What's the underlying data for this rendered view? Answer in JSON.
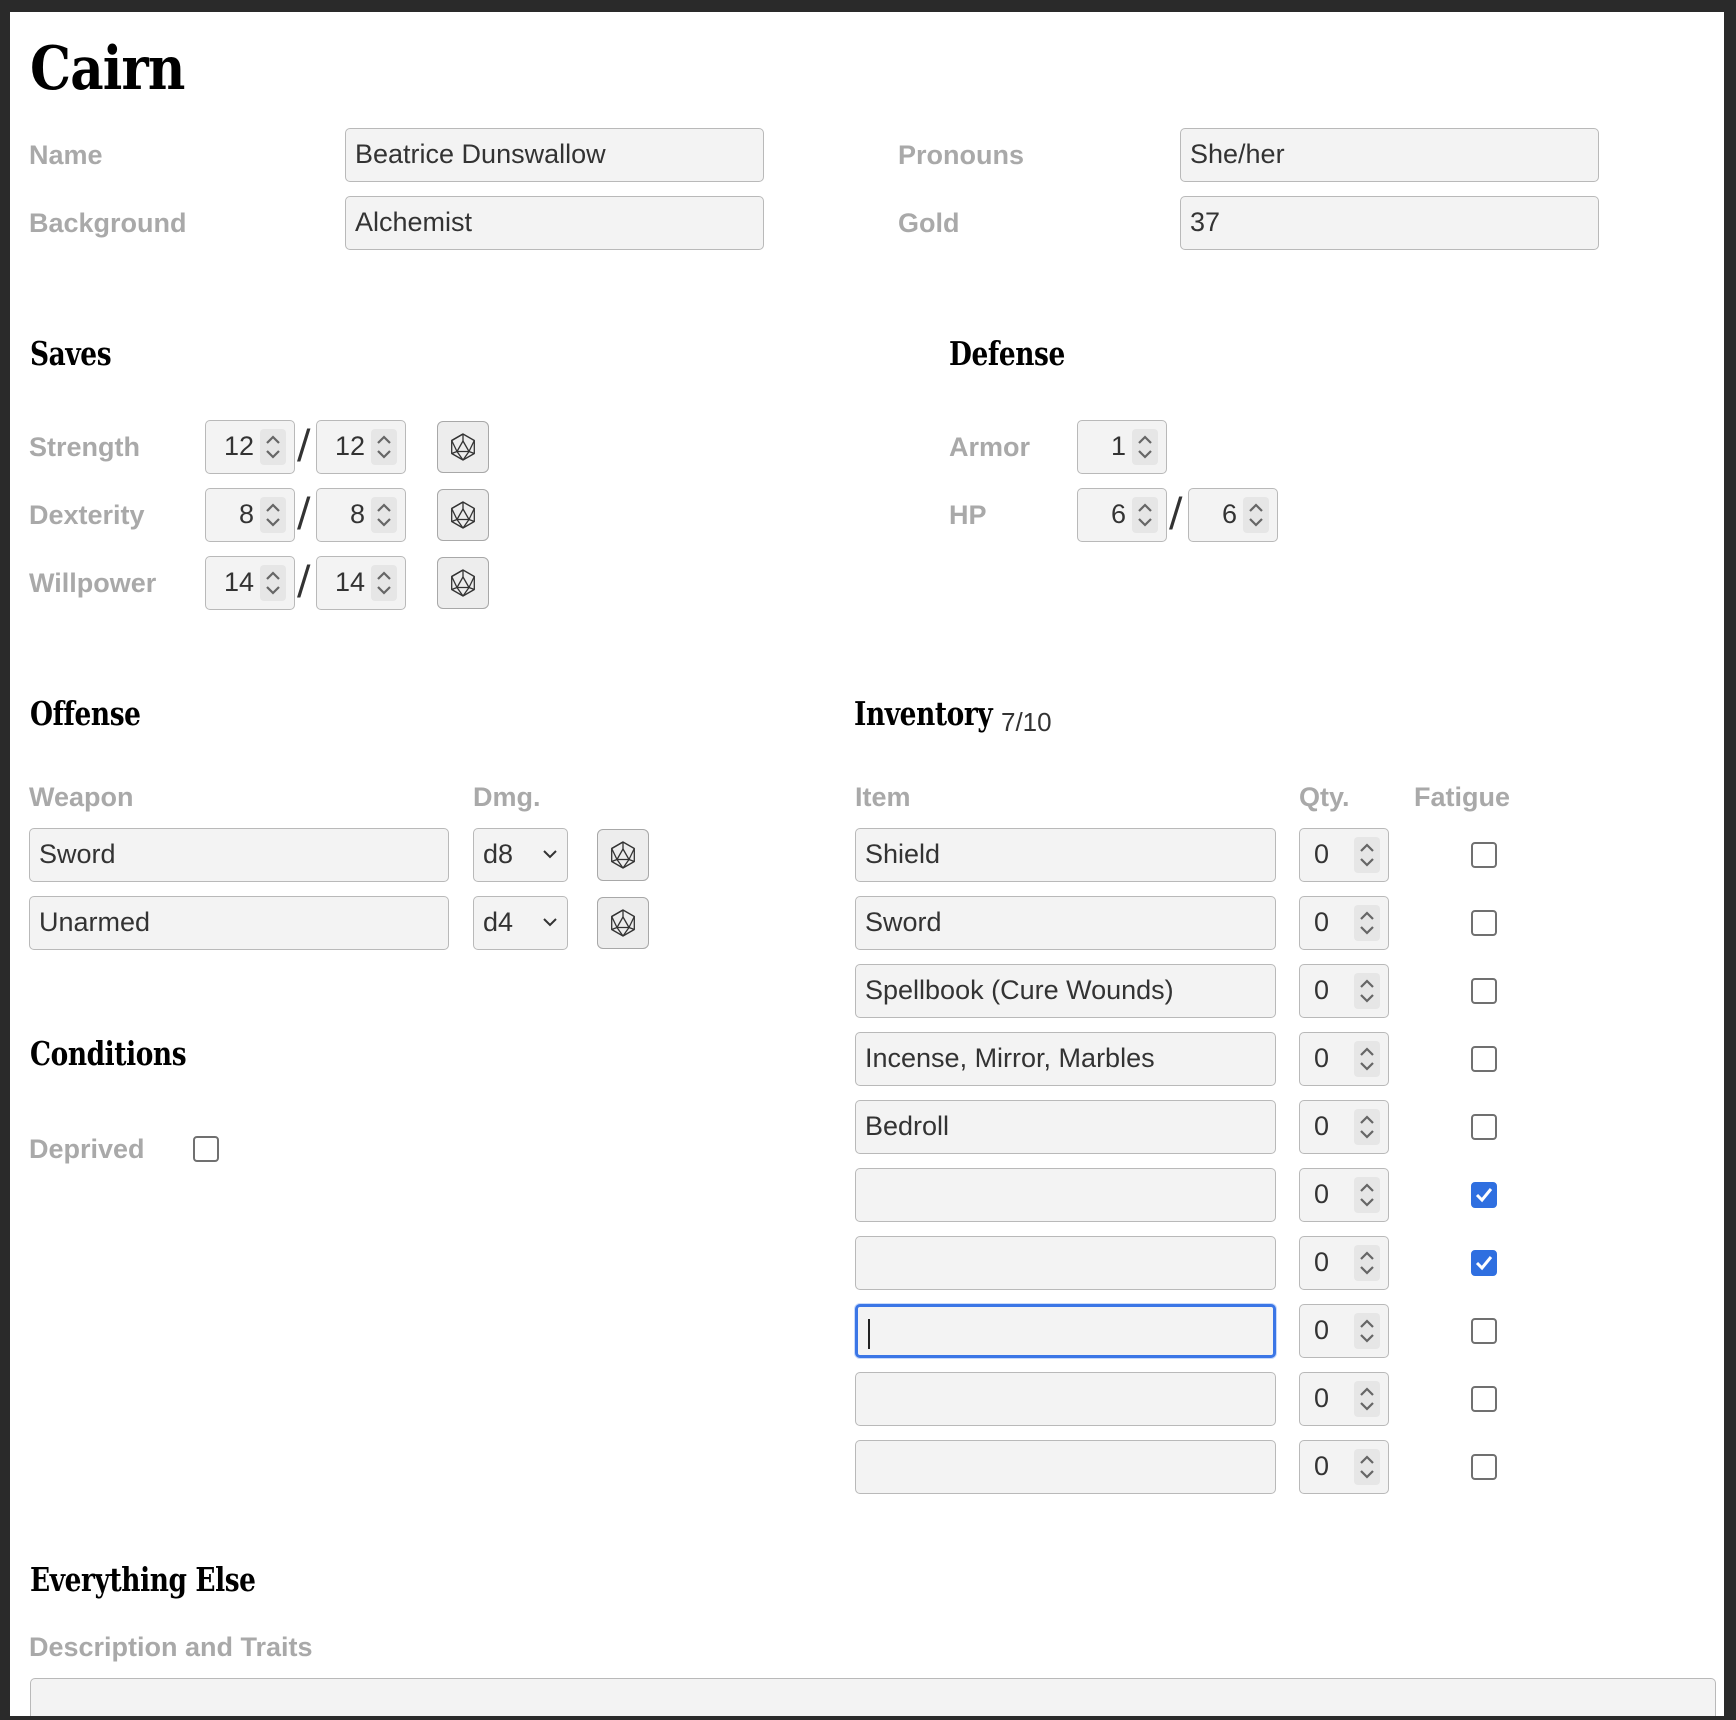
{
  "app": {
    "title": "Cairn"
  },
  "character": {
    "name_label": "Name",
    "name": "Beatrice Dunswallow",
    "pronouns_label": "Pronouns",
    "pronouns": "She/her",
    "background_label": "Background",
    "background": "Alchemist",
    "gold_label": "Gold",
    "gold": "37"
  },
  "saves": {
    "title": "Saves",
    "rows": [
      {
        "label": "Strength",
        "current": "12",
        "max": "12"
      },
      {
        "label": "Dexterity",
        "current": "8",
        "max": "8"
      },
      {
        "label": "Willpower",
        "current": "14",
        "max": "14"
      }
    ],
    "separator": "/"
  },
  "defense": {
    "title": "Defense",
    "armor_label": "Armor",
    "armor": "1",
    "hp_label": "HP",
    "hp_current": "6",
    "hp_max": "6"
  },
  "offense": {
    "title": "Offense",
    "weapon_header": "Weapon",
    "damage_header": "Dmg.",
    "weapons": [
      {
        "name": "Sword",
        "damage": "d8"
      },
      {
        "name": "Unarmed",
        "damage": "d4"
      }
    ]
  },
  "inventory": {
    "title": "Inventory",
    "count": "7/10",
    "item_header": "Item",
    "qty_header": "Qty.",
    "fatigue_header": "Fatigue",
    "items": [
      {
        "name": "Shield",
        "qty": "0",
        "fatigue": false
      },
      {
        "name": "Sword",
        "qty": "0",
        "fatigue": false
      },
      {
        "name": "Spellbook (Cure Wounds)",
        "qty": "0",
        "fatigue": false
      },
      {
        "name": "Incense, Mirror, Marbles",
        "qty": "0",
        "fatigue": false
      },
      {
        "name": "Bedroll",
        "qty": "0",
        "fatigue": false
      },
      {
        "name": "",
        "qty": "0",
        "fatigue": true
      },
      {
        "name": "",
        "qty": "0",
        "fatigue": true
      },
      {
        "name": "",
        "qty": "0",
        "fatigue": false,
        "focused": true
      },
      {
        "name": "",
        "qty": "0",
        "fatigue": false
      },
      {
        "name": "",
        "qty": "0",
        "fatigue": false
      }
    ]
  },
  "conditions": {
    "title": "Conditions",
    "deprived_label": "Deprived",
    "deprived": false
  },
  "everything_else": {
    "title": "Everything Else",
    "description_label": "Description and Traits",
    "description": ""
  },
  "colors": {
    "accent": "#2f6fe0",
    "label_gray": "#a9a9a9",
    "field_bg": "#f3f3f3"
  },
  "icons": {
    "dice": "d20-dice-icon",
    "spinner": "spinner-arrows-icon",
    "select": "chevron-down-icon",
    "check": "checkmark-icon"
  }
}
